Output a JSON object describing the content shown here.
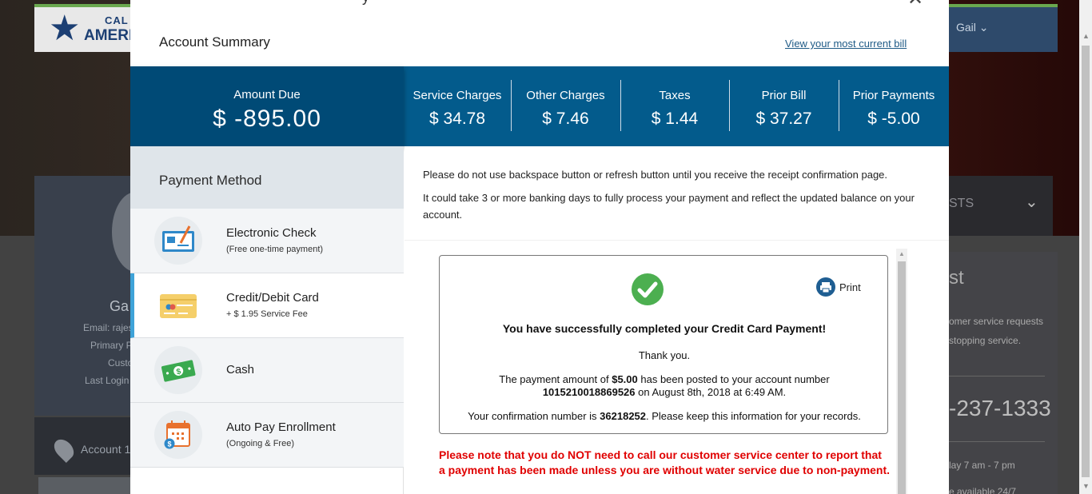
{
  "background": {
    "logo_line1": "CAL",
    "logo_line2": "AMERI",
    "user_name": "Gail",
    "profile": {
      "name": "Ga",
      "email": "Email: rajes",
      "primary": "Primary P",
      "customer": "Custo",
      "last_login": "Last Login"
    },
    "account_label": "Account 1",
    "right_panel": {
      "section_suffix": "STS",
      "list_suffix": "st",
      "line1": "omer service requests",
      "line2": "stopping service.",
      "phone": "-237-1333",
      "hours": "lay 7 am - 7 pm",
      "available": "e available 24/7"
    }
  },
  "modal": {
    "title_fragment": "y",
    "close_glyph": "✕",
    "summary_title": "Account Summary",
    "bill_link": "View your most current bill",
    "amount_due": {
      "label": "Amount Due",
      "value": "$ -895.00"
    },
    "charges": [
      {
        "label": "Service Charges",
        "value": "$ 34.78"
      },
      {
        "label": "Other Charges",
        "value": "$ 7.46"
      },
      {
        "label": "Taxes",
        "value": "$ 1.44"
      },
      {
        "label": "Prior Bill",
        "value": "$ 37.27"
      },
      {
        "label": "Prior Payments",
        "value": "$ -5.00"
      }
    ],
    "payment_method": {
      "header": "Payment Method",
      "items": [
        {
          "title": "Electronic Check",
          "subtitle": "(Free one-time payment)",
          "icon": "check-icon"
        },
        {
          "title": "Credit/Debit Card",
          "subtitle": "+ $ 1.95 Service Fee",
          "icon": "credit-card-icon"
        },
        {
          "title": "Cash",
          "subtitle": "",
          "icon": "cash-icon"
        },
        {
          "title": "Auto Pay Enrollment",
          "subtitle": "(Ongoing & Free)",
          "icon": "calendar-icon"
        }
      ]
    },
    "notice": {
      "line1": "Please do not use backspace button or refresh button until you receive the receipt confirmation page.",
      "line2": "It could take 3 or more banking days to fully process your payment and reflect the updated balance on your account."
    },
    "receipt": {
      "print_label": "Print",
      "headline": "You have successfully completed your Credit Card Payment!",
      "thanks": "Thank you.",
      "line1_prefix": "The payment amount of ",
      "amount": "$5.00",
      "line1_suffix": " has been posted to your account number",
      "account_number": "1015210018869526",
      "line2_suffix": " on August 8th, 2018 at 6:49 AM.",
      "line3_prefix": "Your confirmation number is ",
      "confirmation_number": "36218252",
      "line3_suffix": ". Please keep this information for your records."
    },
    "red_note": "Please note that you do NOT need to call our customer service center to report that a payment has been made unless you are without water service due to non-payment."
  },
  "colors": {
    "band": "#035b8c",
    "amount_due_bg": "#004a76",
    "active_accent": "#3fa3d8",
    "success": "#4caf50",
    "warning_red": "#e00000",
    "link": "#1e5a86"
  }
}
